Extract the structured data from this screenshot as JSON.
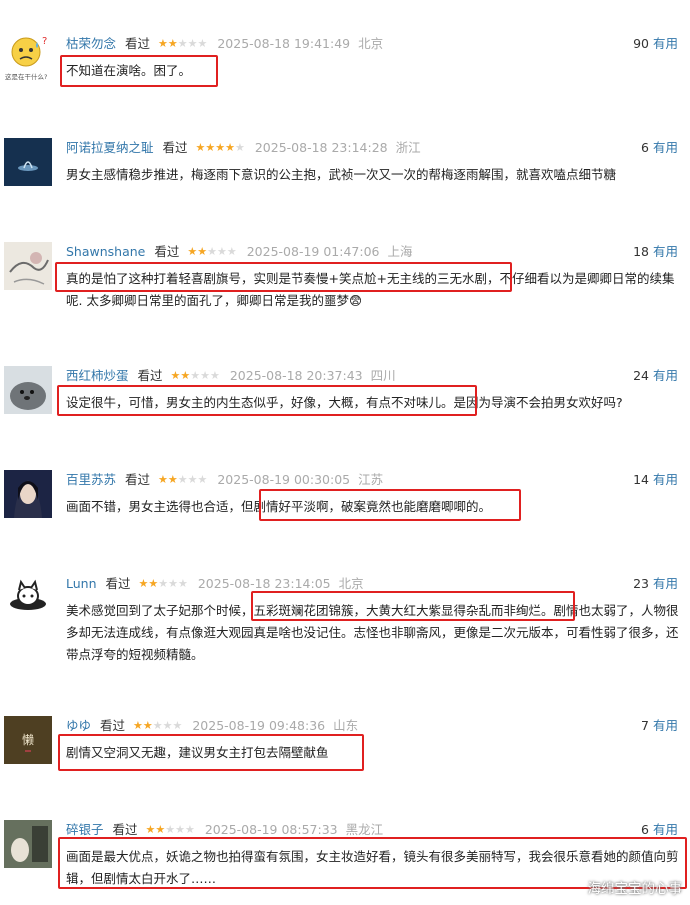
{
  "vote_label": "有用",
  "status_label": "看过",
  "comments": [
    {
      "user": "枯荣勿念",
      "rating": 2,
      "time": "2025-08-18 19:41:49",
      "location": "北京",
      "votes": "90",
      "text": "不知道在演啥。困了。",
      "avatar_caption": "这是在干什么?",
      "avatar_icon": "sweating-smiley-icon"
    },
    {
      "user": "阿诺拉夏纳之耻",
      "rating": 4,
      "time": "2025-08-18 23:14:28",
      "location": "浙江",
      "votes": "6",
      "text": "男女主感情稳步推进，梅逐雨下意识的公主抱，武祯一次又一次的帮梅逐雨解围，就喜欢嗑点细节糖",
      "avatar_icon": "dark-blue-avatar-icon"
    },
    {
      "user": "Shawnshane",
      "rating": 2,
      "time": "2025-08-19 01:47:06",
      "location": "上海",
      "votes": "18",
      "text": "真的是怕了这种打着轻喜剧旗号，实则是节奏慢+笑点尬+无主线的三无水剧，不仔细看以为是卿卿日常的续集呢. 太多卿卿日常里的面孔了，卿卿日常是我的噩梦😨",
      "avatar_icon": "ink-painting-avatar-icon"
    },
    {
      "user": "西红柿炒蛋",
      "rating": 2,
      "time": "2025-08-18 20:37:43",
      "location": "四川",
      "votes": "24",
      "text": "设定很牛，可惜，男女主的内生态似乎，好像，大概，有点不对味儿。是因为导演不会拍男女欢好吗?",
      "avatar_icon": "seal-avatar-icon"
    },
    {
      "user": "百里苏苏",
      "rating": 2,
      "time": "2025-08-19 00:30:05",
      "location": "江苏",
      "votes": "14",
      "text": "画面不错，男女主选得也合适，但剧情好平淡啊，破案竟然也能磨磨唧唧的。",
      "avatar_icon": "anime-character-avatar-icon"
    },
    {
      "user": "Lunn",
      "rating": 2,
      "time": "2025-08-18 23:14:05",
      "location": "北京",
      "votes": "23",
      "text": "美术感觉回到了太子妃那个时候，五彩斑斓花团锦簇，大黄大红大紫显得杂乱而非绚烂。剧情也太弱了，人物很多却无法连成线，有点像逛大观园真是啥也没记住。志怪也非聊斋风，更像是二次元版本，可看性弱了很多，还带点浮夸的短视频精髓。",
      "avatar_icon": "cartoon-cat-avatar-icon"
    },
    {
      "user": "ゆゆ",
      "rating": 2,
      "time": "2025-08-19 09:48:36",
      "location": "山东",
      "votes": "7",
      "text": "剧情又空洞又无趣，建议男女主打包去隔壁献鱼",
      "avatar_caption": "懒",
      "avatar_icon": "calligraphy-avatar-icon"
    },
    {
      "user": "碎银子",
      "rating": 2,
      "time": "2025-08-19 08:57:33",
      "location": "黑龙江",
      "votes": "6",
      "text": "画面是最大优点，妖诡之物也拍得蛮有氛围，女主妆造好看，镜头有很多美丽特写，我会很乐意看她的颜值向剪辑，但剧情太白开水了……",
      "avatar_icon": "photo-avatar-icon"
    }
  ],
  "watermark": "海绵宝宝的心事",
  "colors": {
    "username": "#3377aa",
    "star": "#f6a623",
    "highlight": "#e02020"
  }
}
